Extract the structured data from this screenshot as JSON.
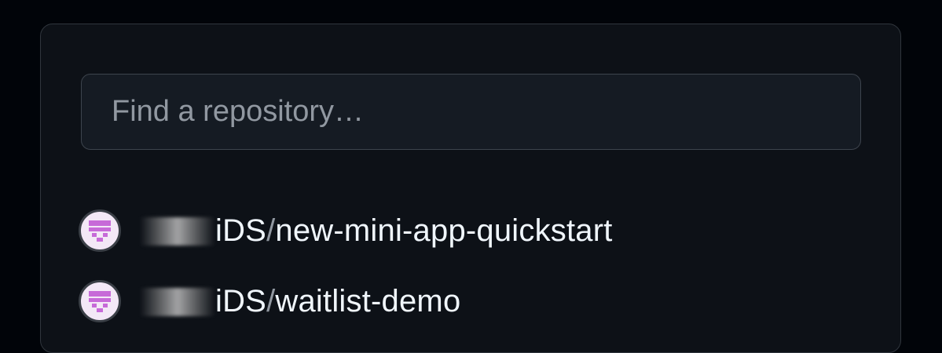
{
  "search": {
    "placeholder": "Find a repository…",
    "value": ""
  },
  "repositories": [
    {
      "owner_suffix": "iDS",
      "separator": "/",
      "name": "new-mini-app-quickstart",
      "avatar_icon": "org-avatar-icon"
    },
    {
      "owner_suffix": "iDS",
      "separator": "/",
      "name": "waitlist-demo",
      "avatar_icon": "org-avatar-icon"
    }
  ],
  "colors": {
    "background": "#010409",
    "panel": "#0d1117",
    "input_bg": "#151b23",
    "avatar_accent": "#c76ad8"
  }
}
